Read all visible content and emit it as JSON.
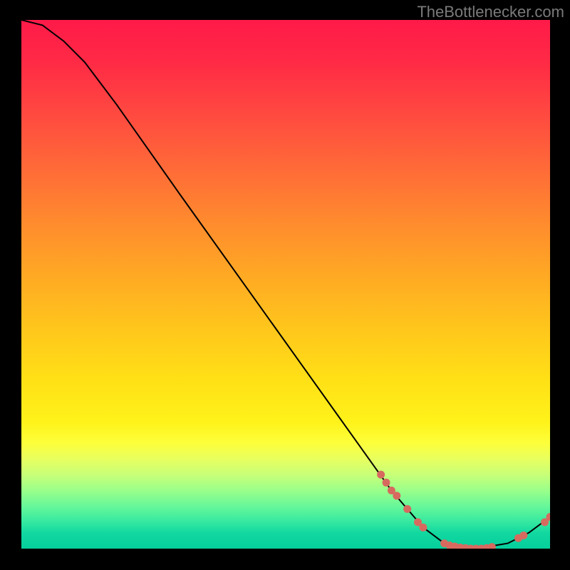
{
  "attribution": "TheBottlenecker.com",
  "chart_data": {
    "type": "line",
    "title": "",
    "xlabel": "",
    "ylabel": "",
    "xlim": [
      0,
      100
    ],
    "ylim": [
      0,
      100
    ],
    "curve": [
      {
        "x": 0,
        "y": 100
      },
      {
        "x": 4,
        "y": 99
      },
      {
        "x": 8,
        "y": 96
      },
      {
        "x": 12,
        "y": 92
      },
      {
        "x": 18,
        "y": 84
      },
      {
        "x": 30,
        "y": 67
      },
      {
        "x": 45,
        "y": 46
      },
      {
        "x": 60,
        "y": 25
      },
      {
        "x": 70,
        "y": 11
      },
      {
        "x": 76,
        "y": 4
      },
      {
        "x": 80,
        "y": 1
      },
      {
        "x": 86,
        "y": 0
      },
      {
        "x": 92,
        "y": 1
      },
      {
        "x": 96,
        "y": 3
      },
      {
        "x": 100,
        "y": 6
      }
    ],
    "markers": [
      {
        "x": 68,
        "y": 14.0
      },
      {
        "x": 69,
        "y": 12.5
      },
      {
        "x": 70,
        "y": 11.0
      },
      {
        "x": 71,
        "y": 10.0
      },
      {
        "x": 73,
        "y": 7.5
      },
      {
        "x": 75,
        "y": 5.0
      },
      {
        "x": 76,
        "y": 4.0
      },
      {
        "x": 80,
        "y": 1.0
      },
      {
        "x": 81,
        "y": 0.6
      },
      {
        "x": 82,
        "y": 0.4
      },
      {
        "x": 83,
        "y": 0.2
      },
      {
        "x": 84,
        "y": 0.1
      },
      {
        "x": 85,
        "y": 0.0
      },
      {
        "x": 86,
        "y": 0.0
      },
      {
        "x": 87,
        "y": 0.0
      },
      {
        "x": 88,
        "y": 0.1
      },
      {
        "x": 89,
        "y": 0.3
      },
      {
        "x": 94,
        "y": 2.0
      },
      {
        "x": 95,
        "y": 2.5
      },
      {
        "x": 99,
        "y": 5.0
      },
      {
        "x": 100,
        "y": 6.0
      }
    ],
    "marker_color": "#d76a5f",
    "curve_color": "#000000"
  }
}
